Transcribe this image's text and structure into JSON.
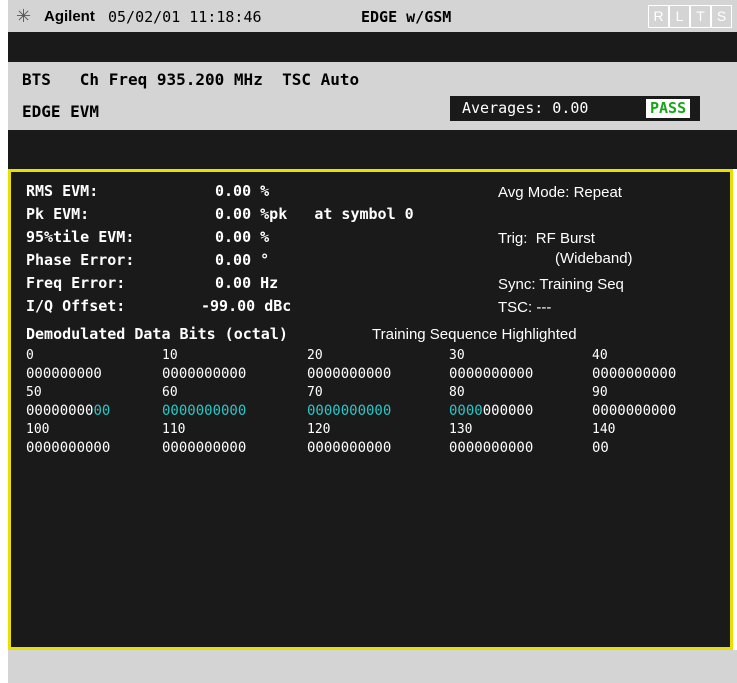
{
  "titlebar": {
    "brand": "Agilent",
    "datetime": "05/02/01 11:18:46",
    "mode": "EDGE w/GSM",
    "indicators": [
      "R",
      "L",
      "T",
      "S"
    ]
  },
  "header": {
    "line1": "BTS   Ch Freq 935.200 MHz  TSC Auto",
    "line2": "EDGE EVM",
    "averages": "Averages: 0.00",
    "status": "PASS"
  },
  "metrics": [
    {
      "label": "RMS EVM:",
      "value": "0.00 %"
    },
    {
      "label": "Pk EVM:",
      "value": "0.00 %pk   at symbol 0"
    },
    {
      "label": "95%tile EVM:",
      "value": "0.00 %"
    },
    {
      "label": "Phase Error:",
      "value": "0.00 °"
    },
    {
      "label": "Freq Error:",
      "value": "0.00 Hz"
    },
    {
      "label": "I/Q Offset:",
      "value": "-99.00 dBc"
    }
  ],
  "settings": {
    "avg_mode": "Avg Mode: Repeat",
    "trig": "Trig:  RF Burst",
    "trig_sub": "(Wideband)",
    "sync": "Sync: Training Seq",
    "tsc": "TSC: ---"
  },
  "demod": {
    "title": "Demodulated Data Bits (octal)",
    "subtitle": "Training Sequence Highlighted",
    "rows": [
      {
        "indices": [
          "0",
          "10",
          "20",
          "30",
          "40"
        ],
        "bits": [
          "000000000",
          "0000000000",
          "0000000000",
          "0000000000",
          "0000000000"
        ]
      },
      {
        "indices": [
          "50",
          "60",
          "70",
          "80",
          "90"
        ],
        "bits": [
          "0000000000",
          "0000000000",
          "0000000000",
          "0000000000",
          "0000000000"
        ]
      },
      {
        "indices": [
          "100",
          "110",
          "120",
          "130",
          "140"
        ],
        "bits": [
          "0000000000",
          "0000000000",
          "0000000000",
          "0000000000",
          "00"
        ]
      }
    ],
    "row2_parts": {
      "c0_plain": "00000000",
      "c0_hl": "00",
      "c1_hl": "0000000000",
      "c2_hl": "0000000000",
      "c3_hl": "0000",
      "c3_plain": "000000"
    }
  },
  "colors": {
    "highlight": "#2ac7c7",
    "pass": "#1aa51a",
    "border": "#e8e000"
  }
}
